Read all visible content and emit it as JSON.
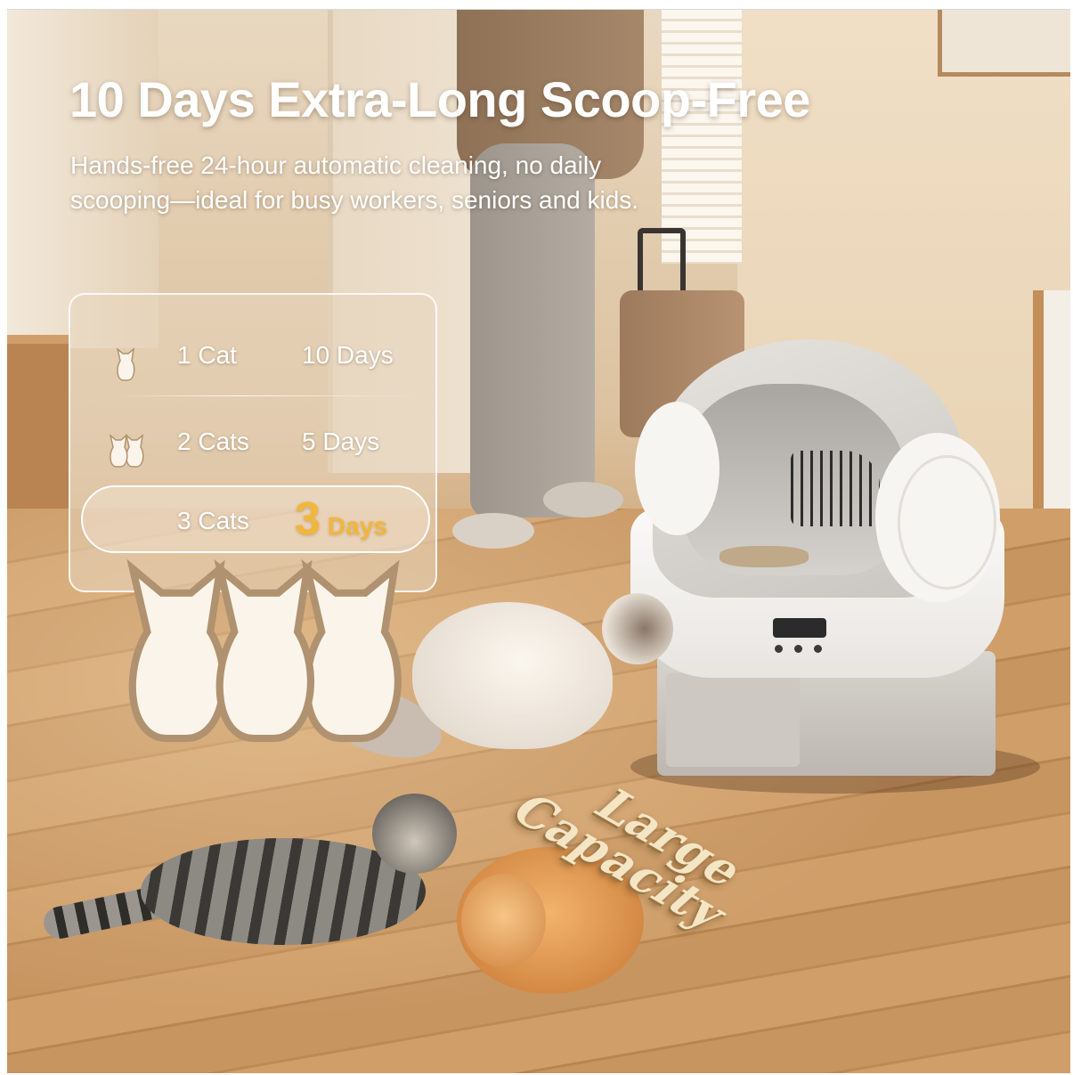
{
  "headline": "10 Days Extra-Long Scoop-Free",
  "subheadline": "Hands-free 24-hour automatic cleaning, no daily scooping—ideal for busy workers, seniors and kids.",
  "table": {
    "rows": [
      {
        "cats": "1 Cat",
        "days": "10 Days",
        "icon": "one-cat-icon",
        "highlighted": false
      },
      {
        "cats": "2 Cats",
        "days": "5 Days",
        "icon": "two-cats-icon",
        "highlighted": false
      },
      {
        "cats": "3 Cats",
        "days_number": "3",
        "days_unit": "Days",
        "icon": "three-cats-icon",
        "highlighted": true
      }
    ],
    "highlight_color": "#f2b63b"
  },
  "badge": {
    "line1": "Large",
    "line2": "Capacity",
    "color": "#f4e5c4"
  }
}
